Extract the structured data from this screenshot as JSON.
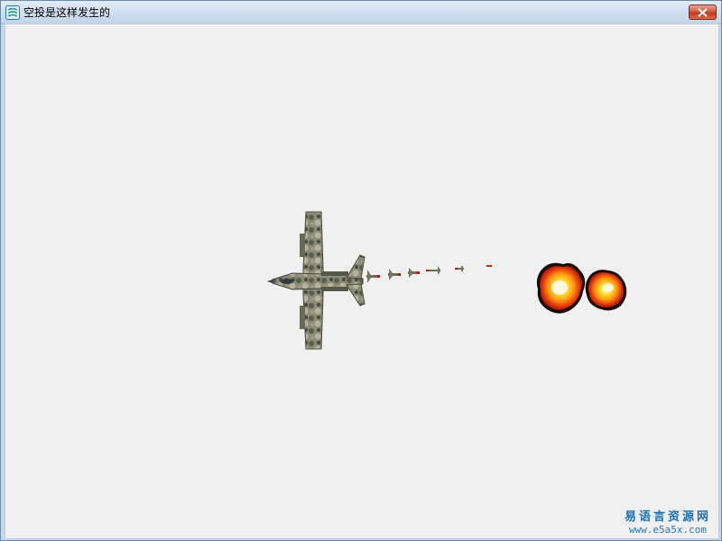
{
  "window": {
    "title": "空投是这样发生的",
    "icon": "app-icon",
    "close_icon": "close-icon",
    "accent": "#c13a20"
  },
  "scene": {
    "aircraft": "attack-jet-icon",
    "projectile_count": 6,
    "explosion_count": 2
  },
  "watermark": {
    "name": "易语言资源网",
    "url": "www.e5a5x.com",
    "color": "#1e6fb3"
  }
}
